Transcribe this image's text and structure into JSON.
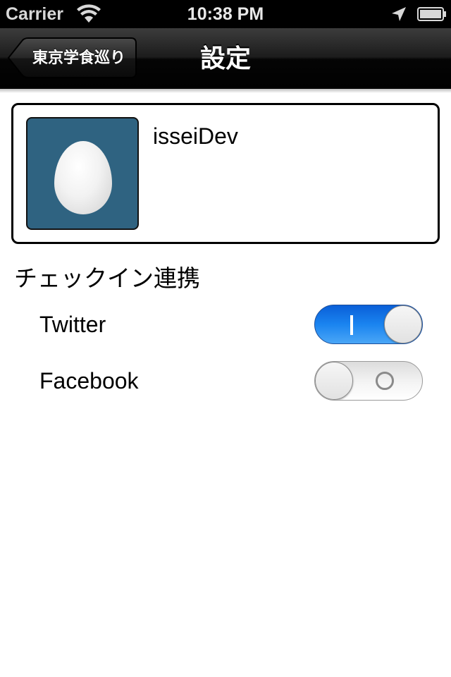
{
  "status_bar": {
    "carrier": "Carrier",
    "time": "10:38 PM",
    "icons": [
      "wifi-icon",
      "location-arrow-icon",
      "battery-icon"
    ]
  },
  "nav_bar": {
    "back_label": "東京学食巡り",
    "title": "設定"
  },
  "profile": {
    "avatar_icon": "egg-avatar",
    "avatar_bg": "#2f6381",
    "username": "isseiDev"
  },
  "checkin_section": {
    "title": "チェックイン連携",
    "items": [
      {
        "label": "Twitter",
        "enabled": true
      },
      {
        "label": "Facebook",
        "enabled": false
      }
    ]
  },
  "colors": {
    "switch_on": "#1a84f0",
    "nav_bar": "#1c1c1c"
  }
}
